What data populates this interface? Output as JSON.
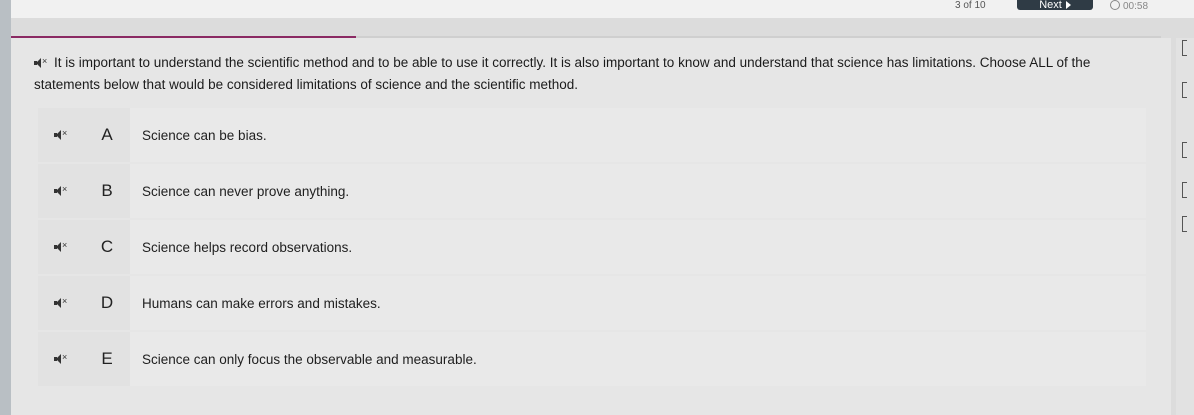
{
  "header": {
    "counter": "3 of 10",
    "next_label": "Next",
    "timer": "00:58"
  },
  "progress": {
    "fraction": 0.3
  },
  "question": {
    "text": "It is important to understand the scientific method and to be able to use it correctly. It is also important to know and understand that science has limitations. Choose ALL of the statements below that would be considered limitations of science and the scientific method."
  },
  "options": [
    {
      "letter": "A",
      "text": "Science can be bias."
    },
    {
      "letter": "B",
      "text": "Science can never prove anything."
    },
    {
      "letter": "C",
      "text": "Science helps record observations."
    },
    {
      "letter": "D",
      "text": "Humans can make errors and mistakes."
    },
    {
      "letter": "E",
      "text": "Science can only focus the observable and measurable."
    }
  ],
  "icons": {
    "speaker": "speaker-icon",
    "clock": "clock-icon",
    "next": "play-arrow-icon"
  },
  "colors": {
    "progress": "#8b2a63",
    "next_button": "#2f3b45"
  }
}
